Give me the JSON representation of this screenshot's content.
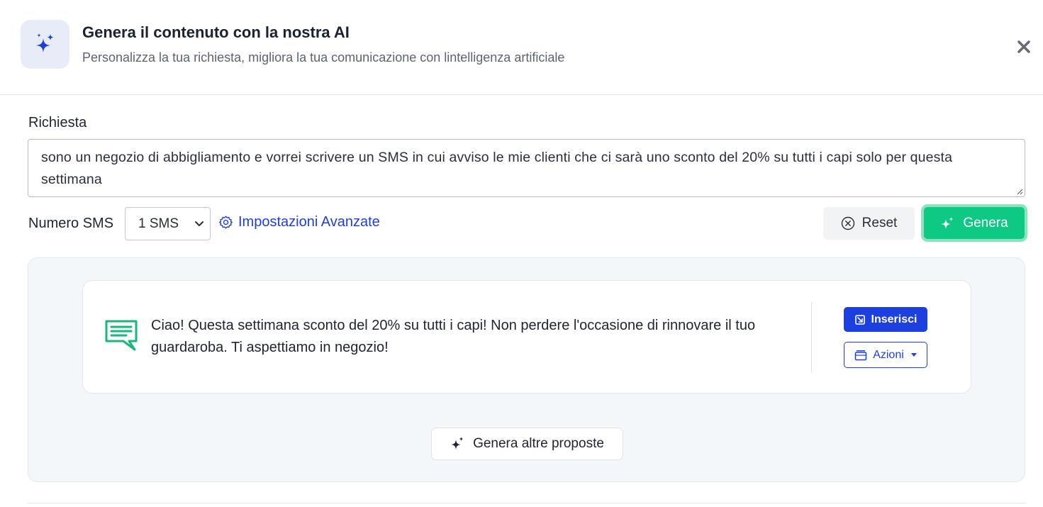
{
  "header": {
    "icon": "sparkles-icon",
    "title": "Genera il contenuto con la nostra AI",
    "subtitle": "Personalizza la tua richiesta, migliora la tua comunicazione con lintelligenza artificiale",
    "close_icon": "close-icon"
  },
  "form": {
    "request_label": "Richiesta",
    "request_value": "sono un negozio di abbigliamento e vorrei scrivere un SMS in cui avviso le mie clienti che ci sarà uno sconto del 20% su tutti i capi solo per questa settimana",
    "sms_count_label": "Numero SMS",
    "sms_count_value": "1 SMS",
    "advanced_settings": "Impostazioni Avanzate",
    "reset_label": "Reset",
    "generate_label": "Genera"
  },
  "results": {
    "proposals": [
      {
        "text": "Ciao! Questa settimana sconto del 20% su tutti i capi! Non perdere l'occasione di rinnovare il tuo guardaroba. Ti aspettiamo in negozio!",
        "insert_label": "Inserisci",
        "actions_label": "Azioni"
      }
    ],
    "more_label": "Genera altre proposte"
  },
  "colors": {
    "primary_blue": "#1d3fe0",
    "generate_green": "#0dc983",
    "message_icon_green": "#19b87a",
    "panel_bg": "#f4f7fa"
  }
}
